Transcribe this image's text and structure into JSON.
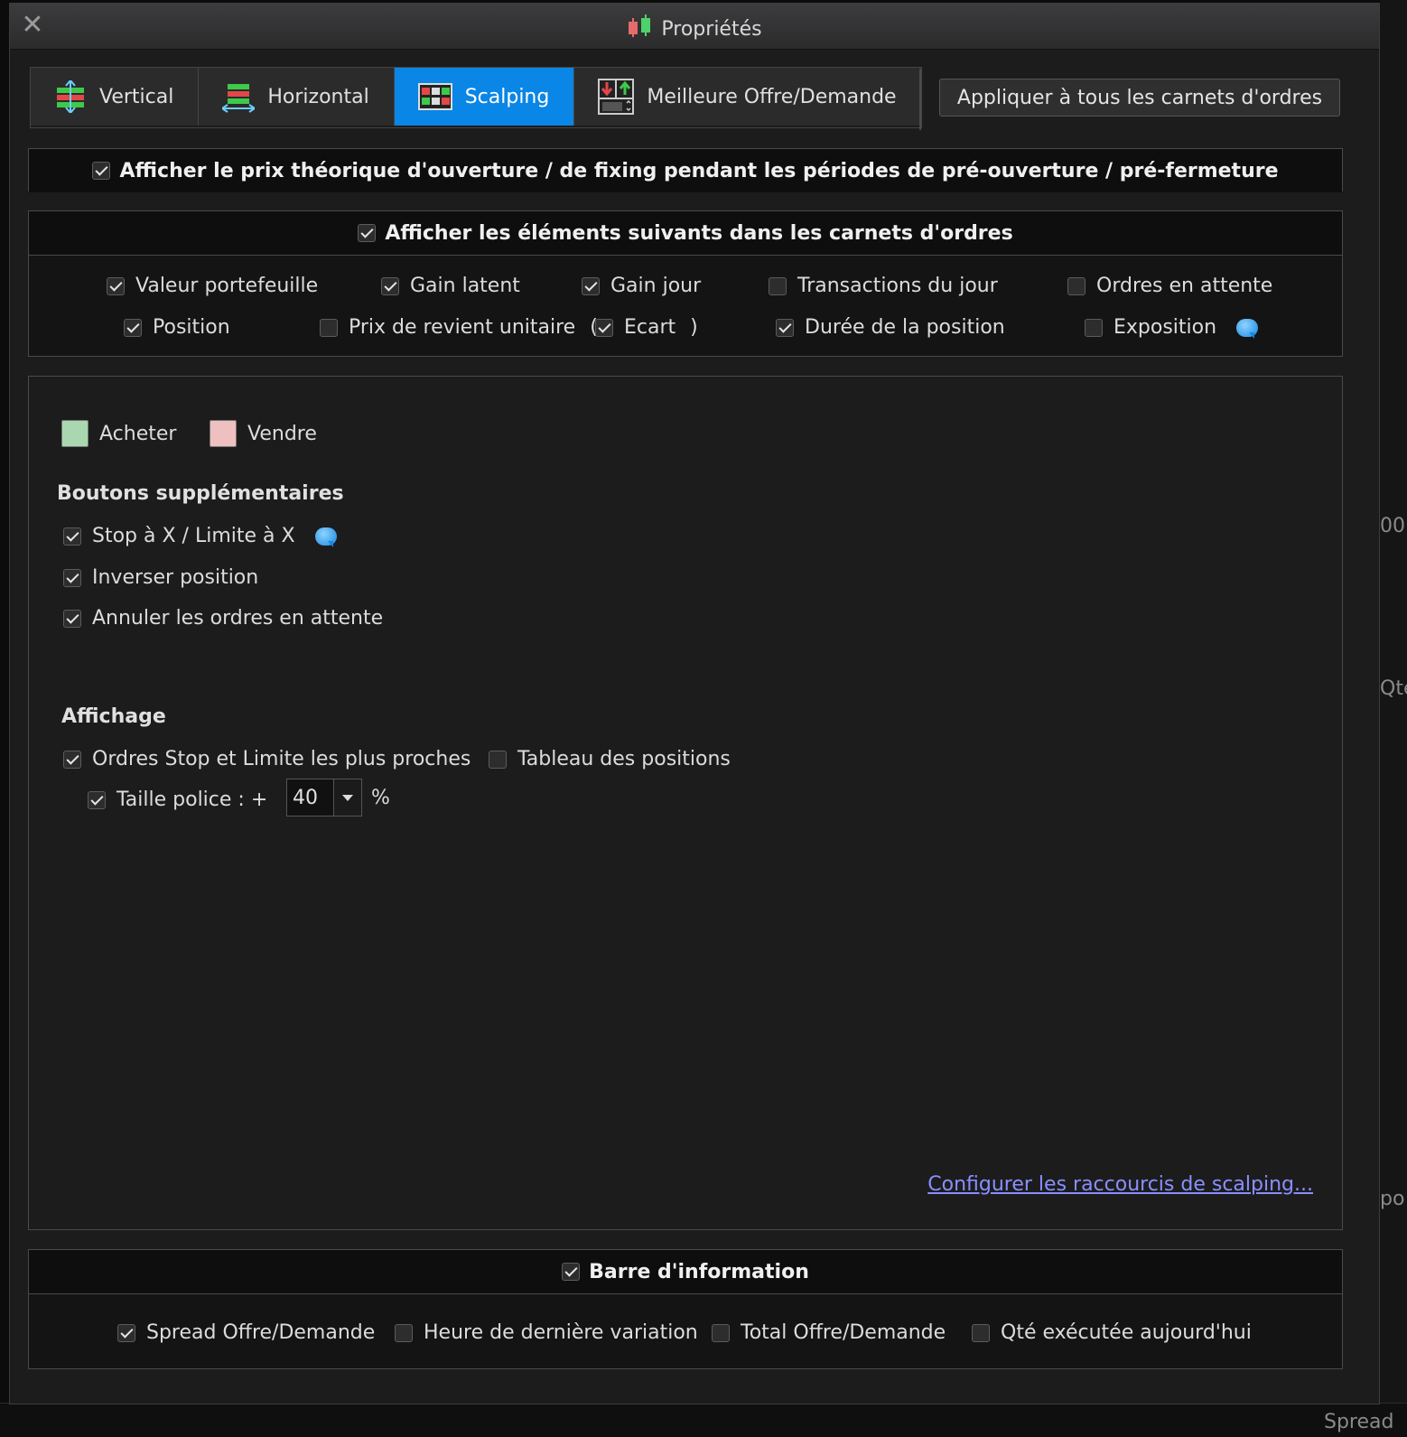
{
  "dialog": {
    "title": "Propriétés",
    "close_label": "✕"
  },
  "tabs": [
    {
      "label": "Vertical",
      "icon": "vertical-layout-icon",
      "active": false
    },
    {
      "label": "Horizontal",
      "icon": "horizontal-layout-icon",
      "active": false
    },
    {
      "label": "Scalping",
      "icon": "scalping-grid-icon",
      "active": true
    },
    {
      "label": "Meilleure Offre/Demande",
      "icon": "best-bid-ask-icon",
      "active": false
    }
  ],
  "apply_button": "Appliquer à tous les carnets d'ordres",
  "theoretical_price": {
    "label": "Afficher le prix théorique d'ouverture / de fixing pendant les périodes de pré-ouverture / pré-fermeture",
    "checked": true
  },
  "orderbook_elements": {
    "label": "Afficher les éléments suivants dans les carnets d'ordres",
    "checked": true,
    "items": {
      "portfolio_value": {
        "label": "Valeur portefeuille",
        "checked": true
      },
      "unrealized_gain": {
        "label": "Gain latent",
        "checked": true
      },
      "day_gain": {
        "label": "Gain jour",
        "checked": true
      },
      "day_transactions": {
        "label": "Transactions du jour",
        "checked": false
      },
      "pending_orders": {
        "label": "Ordres en attente",
        "checked": false
      },
      "position": {
        "label": "Position",
        "checked": true
      },
      "unit_cost": {
        "label": "Prix de revient unitaire",
        "checked": false
      },
      "open_paren": "(",
      "spread": {
        "label": "Ecart",
        "checked": true
      },
      "close_paren": ")",
      "position_duration": {
        "label": "Durée de la position",
        "checked": true
      },
      "exposure": {
        "label": "Exposition",
        "checked": false
      }
    }
  },
  "scalping": {
    "buy_label": "Acheter",
    "sell_label": "Vendre",
    "buy_color": "#a9d8b0",
    "sell_color": "#eec0c0",
    "extra_buttons_title": "Boutons supplémentaires",
    "extra_buttons": {
      "stop_limit": {
        "label": "Stop à X / Limite à X",
        "checked": true
      },
      "reverse": {
        "label": "Inverser position",
        "checked": true
      },
      "cancel": {
        "label": "Annuler les ordres en attente",
        "checked": true
      }
    },
    "display_title": "Affichage",
    "display": {
      "nearest": {
        "label": "Ordres Stop et Limite les plus proches",
        "checked": true
      },
      "positions_table": {
        "label": "Tableau des positions",
        "checked": false
      },
      "font_size": {
        "label": "Taille police : +",
        "checked": true,
        "value": "40",
        "unit": "%"
      }
    },
    "shortcuts_link": "Configurer les raccourcis de scalping..."
  },
  "info_bar": {
    "label": "Barre d'information",
    "checked": true,
    "items": {
      "spread": {
        "label": "Spread Offre/Demande",
        "checked": true
      },
      "last_change": {
        "label": "Heure de dernière variation",
        "checked": false
      },
      "total": {
        "label": "Total Offre/Demande",
        "checked": false
      },
      "qty_today": {
        "label": "Qté exécutée aujourd'hui",
        "checked": false
      }
    }
  },
  "background": {
    "right_labels": [
      "00",
      "Qte",
      "po"
    ],
    "bottom_label": "Spread"
  }
}
